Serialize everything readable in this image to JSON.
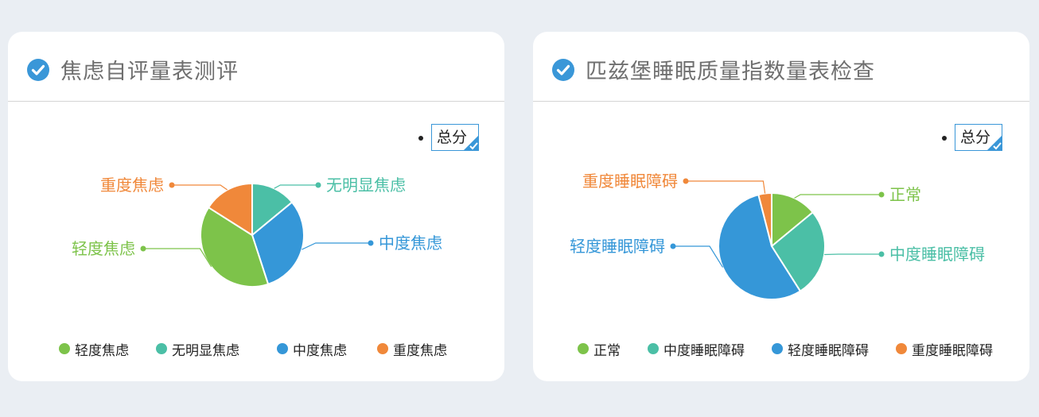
{
  "colors": {
    "green": "#7dc34a",
    "teal": "#4bbfa6",
    "blue": "#3597d8",
    "orange": "#f0883a",
    "check_blue": "#3a97d8"
  },
  "toggle_label": "总分",
  "chart_data": [
    {
      "type": "pie",
      "title": "焦虑自评量表测评",
      "slices": [
        {
          "label": "无明显焦虑",
          "value": 14,
          "color": "#4bbfa6"
        },
        {
          "label": "中度焦虑",
          "value": 31,
          "color": "#3597d8"
        },
        {
          "label": "轻度焦虑",
          "value": 39,
          "color": "#7dc34a"
        },
        {
          "label": "重度焦虑",
          "value": 16,
          "color": "#f0883a"
        }
      ],
      "legend": [
        "轻度焦虑",
        "无明显焦虑",
        "中度焦虑",
        "重度焦虑"
      ],
      "legend_position": "bottom"
    },
    {
      "type": "pie",
      "title": "匹兹堡睡眠质量指数量表检查",
      "slices": [
        {
          "label": "正常",
          "value": 14,
          "color": "#7dc34a"
        },
        {
          "label": "中度睡眠障碍",
          "value": 27,
          "color": "#4bbfa6"
        },
        {
          "label": "轻度睡眠障碍",
          "value": 55,
          "color": "#3597d8"
        },
        {
          "label": "重度睡眠障碍",
          "value": 4,
          "color": "#f0883a"
        }
      ],
      "legend": [
        "正常",
        "中度睡眠障碍",
        "轻度睡眠障碍",
        "重度睡眠障碍"
      ],
      "legend_position": "bottom"
    }
  ]
}
